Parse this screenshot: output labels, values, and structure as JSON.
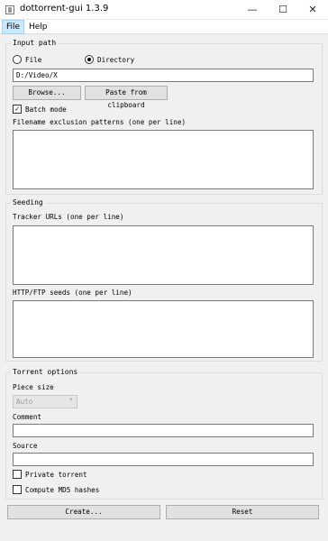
{
  "window": {
    "title": "dottorrent-gui 1.3.9",
    "minimize_glyph": "—",
    "maximize_glyph": "☐",
    "close_glyph": "✕"
  },
  "menubar": {
    "items": [
      {
        "label": "File"
      },
      {
        "label": "Help"
      }
    ]
  },
  "input_path": {
    "title": "Input path",
    "file_label": "File",
    "directory_label": "Directory",
    "selected_mode": "Directory",
    "path_value": "D:/Video/X",
    "browse_label": "Browse...",
    "paste_label": "Paste from clipboard",
    "batch_mode_label": "Batch mode",
    "batch_mode_checked": true,
    "exclusion_label": "Filename exclusion patterns (one per line)",
    "exclusion_value": ""
  },
  "seeding": {
    "title": "Seeding",
    "tracker_label": "Tracker URLs (one per line)",
    "tracker_value": "",
    "http_label": "HTTP/FTP seeds (one per line)",
    "http_value": ""
  },
  "torrent_options": {
    "title": "Torrent options",
    "piece_size_label": "Piece size",
    "piece_size_value": "Auto",
    "comment_label": "Comment",
    "comment_value": "",
    "source_label": "Source",
    "source_value": "",
    "private_label": "Private torrent",
    "private_checked": false,
    "md5_label": "Compute MD5 hashes",
    "md5_checked": false
  },
  "actions": {
    "create_label": "Create...",
    "reset_label": "Reset"
  },
  "glyphs": {
    "check": "✓",
    "chevron": "▾"
  }
}
